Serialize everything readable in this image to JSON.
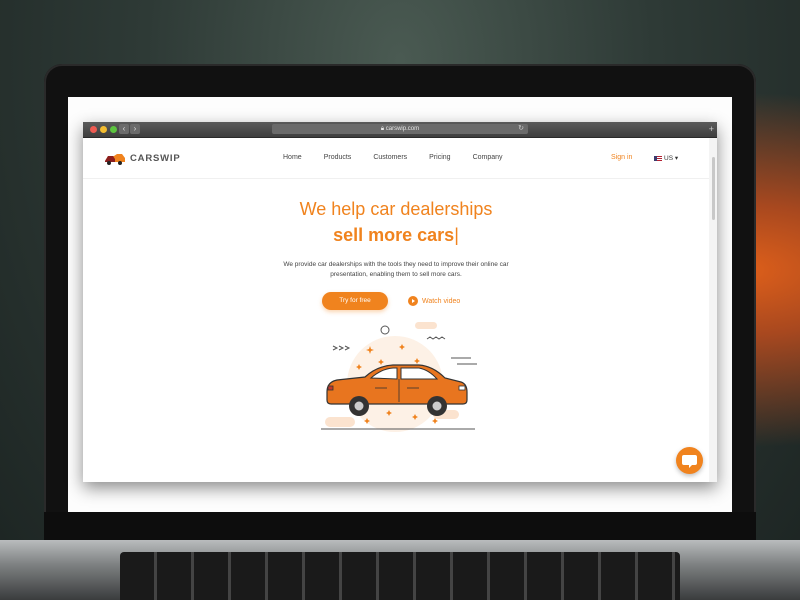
{
  "browser": {
    "url": "carswip.com",
    "back_icon": "chevron-left-icon",
    "forward_icon": "chevron-right-icon"
  },
  "header": {
    "brand": "CARSWIP",
    "nav": [
      "Home",
      "Products",
      "Customers",
      "Pricing",
      "Company"
    ],
    "signin": "Sign in",
    "locale": "US"
  },
  "hero": {
    "headline_line1": "We help car dealerships",
    "headline_line2": "sell more cars",
    "cursor": "|",
    "description": "We provide car dealerships with the tools they need to improve their online car presentation, enabling them to sell more cars.",
    "cta_primary": "Try for free",
    "cta_secondary": "Watch video"
  },
  "colors": {
    "accent": "#f0831e",
    "car_body": "#e8751f",
    "text": "#444444"
  },
  "icons": {
    "chat": "chat-bubble-icon",
    "play": "play-icon",
    "locale_flag": "us-flag-icon"
  }
}
